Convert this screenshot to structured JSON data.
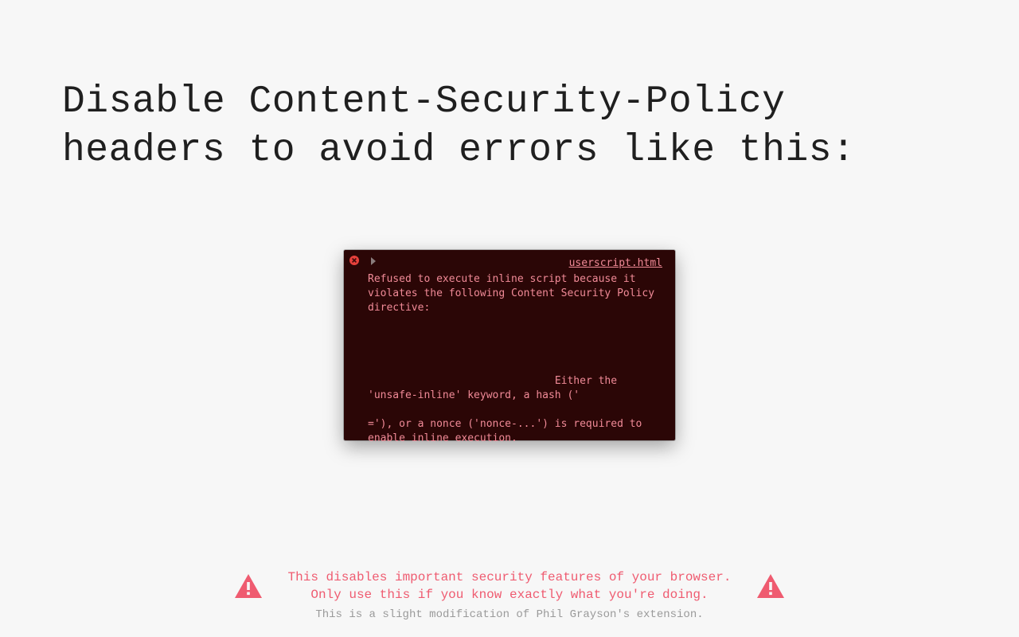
{
  "headline": "Disable Content-Security-Policy headers to avoid errors like this:",
  "console": {
    "source_link": "userscript.html",
    "message_top": "Refused to execute inline script because it violates the following Content Security Policy directive:",
    "message_bottom": "                              Either the\n'unsafe-inline' keyword, a hash ('\n\n='), or a nonce ('nonce-...') is required to enable inline execution."
  },
  "footer": {
    "warning_line1": "This disables important security features of your browser.",
    "warning_line2": "Only use this if you know exactly what you're doing.",
    "attribution": "This is a slight modification of Phil Grayson's extension."
  },
  "colors": {
    "accent": "#ef5b70",
    "console_bg": "#2b0606",
    "console_fg": "#f08a97"
  }
}
